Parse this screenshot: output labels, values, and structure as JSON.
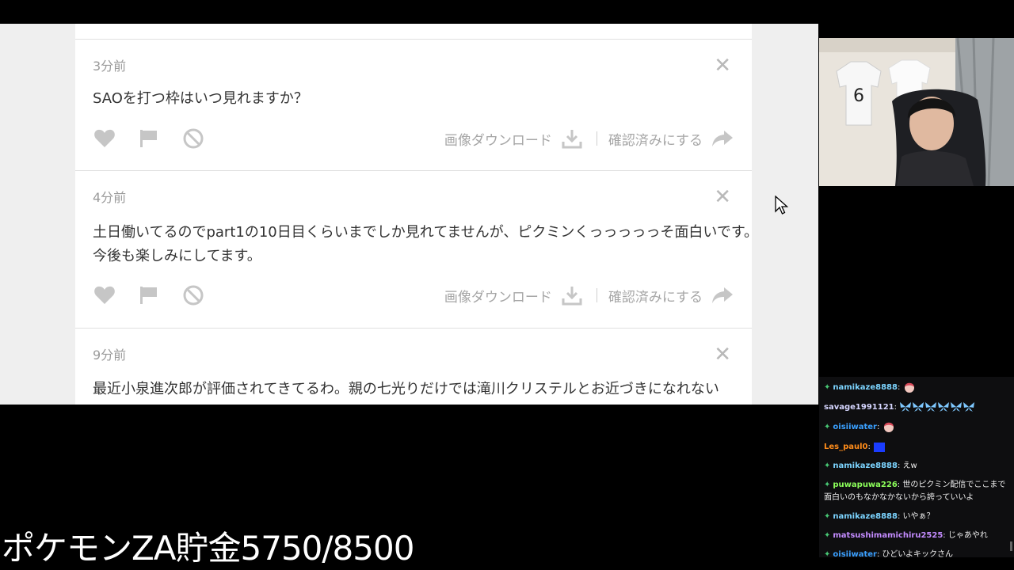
{
  "comments": [
    {
      "time": "3分前",
      "lines": [
        "SAOを打つ枠はいつ見れますか？"
      ]
    },
    {
      "time": "4分前",
      "lines": [
        "土日働いてるのでpart1の10日目くらいまでしか見れてませんが、ピクミンくっっっっっそ面白いです。",
        "今後も楽しみにしてます。"
      ]
    },
    {
      "time": "9分前",
      "lines": [
        "最近小泉進次郎が評価されてきてるわ。親の七光りだけでは滝川クリステルとお近づきになれない"
      ]
    }
  ],
  "actions": {
    "download_label": "画像ダウンロード",
    "confirm_label": "確認済みにする"
  },
  "chat": [
    {
      "user": "namikaze8888",
      "color": "#7cd4ff",
      "badge": true,
      "text": "",
      "emotes": [
        "chibi-face"
      ]
    },
    {
      "user": "savage1991121",
      "color": "#d6d6ff",
      "badge": false,
      "text": "",
      "emotes": [
        "butterfly",
        "butterfly",
        "butterfly",
        "butterfly",
        "butterfly",
        "butterfly"
      ]
    },
    {
      "user": "oisiiwater",
      "color": "#3aa0ff",
      "badge": true,
      "text": "",
      "emotes": [
        "chibi-face"
      ]
    },
    {
      "user": "Les_paul0",
      "color": "#ff8c1a",
      "badge": false,
      "text": "",
      "emotes": [
        "blue-square"
      ]
    },
    {
      "user": "namikaze8888",
      "color": "#7cd4ff",
      "badge": true,
      "text": "えw",
      "emotes": []
    },
    {
      "user": "puwapuwa226",
      "color": "#8cff5a",
      "badge": true,
      "text": "世のピクミン配信でここまで面白いのもなかなかないから誇っていいよ",
      "emotes": []
    },
    {
      "user": "namikaze8888",
      "color": "#7cd4ff",
      "badge": true,
      "text": "いやぁ？",
      "emotes": []
    },
    {
      "user": "matsushimamichiru2525",
      "color": "#c48cff",
      "badge": true,
      "text": "じゃあやれ",
      "emotes": []
    },
    {
      "user": "oisiiwater",
      "color": "#3aa0ff",
      "badge": true,
      "text": "ひどいよキックさん",
      "emotes": []
    }
  ],
  "overlay": {
    "savings_text": "ポケモンZA貯金5750/8500"
  },
  "colors": {
    "icon_gray": "#bdbdbd",
    "chat_bg": "#0e0e10"
  }
}
